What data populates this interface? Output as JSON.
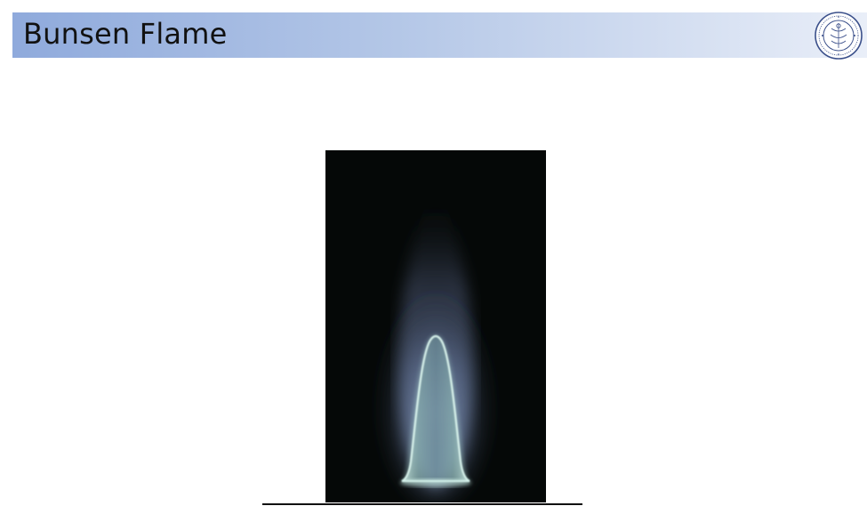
{
  "slide": {
    "title": "Bunsen Flame"
  },
  "logo": {
    "icon": "institute-seal-icon"
  },
  "figure": {
    "icon": "bunsen-flame-photo",
    "colors": {
      "background": "#050807",
      "inner_cone": "#bfe6dc",
      "outer_flame": "#8fa3c8"
    }
  },
  "colors": {
    "title_bar_start": "#8faadc",
    "title_bar_end": "#e9eef8"
  }
}
